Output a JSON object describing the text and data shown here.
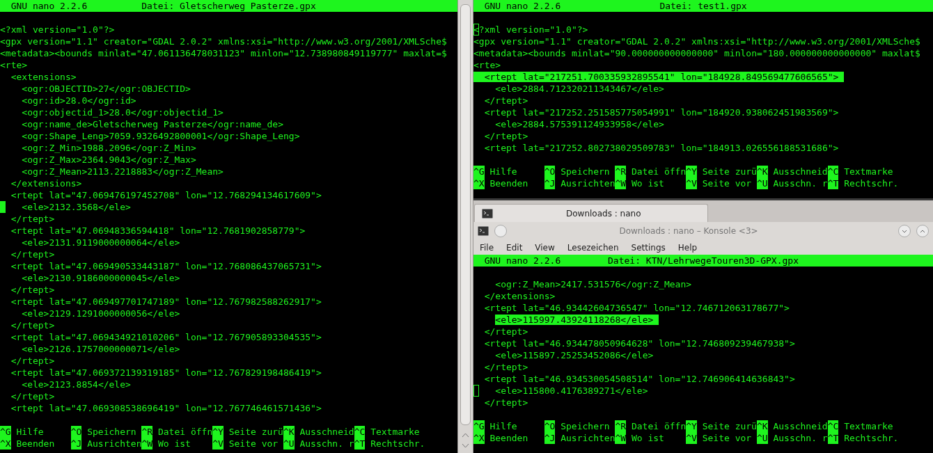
{
  "panes": [
    {
      "title": {
        "program": "GNU nano 2.2.6",
        "file": "Datei: Gletscherweg Pasterze.gpx"
      },
      "lines": [
        {
          "text": "<?xml version=\"1.0\"?>"
        },
        {
          "text": "<gpx version=\"1.1\" creator=\"GDAL 2.0.2\" xmlns:xsi=\"http://www.w3.org/2001/XMLSche$"
        },
        {
          "text": "<metadata><bounds minlat=\"47.061136478031123\" minlon=\"12.738980849119777\" maxlat=$"
        },
        {
          "text": "<rte>"
        },
        {
          "text": "  <extensions>"
        },
        {
          "text": "    <ogr:OBJECTID>27</ogr:OBJECTID>"
        },
        {
          "text": "    <ogr:id>28.0</ogr:id>"
        },
        {
          "text": "    <ogr:objectid_1>28.0</ogr:objectid_1>"
        },
        {
          "text": "    <ogr:name_de>Gletscherweg Pasterze</ogr:name_de>"
        },
        {
          "text": "    <ogr:Shape_Leng>7059.9326492800001</ogr:Shape_Leng>"
        },
        {
          "text": "    <ogr:Z_Min>1988.2096</ogr:Z_Min>"
        },
        {
          "text": "    <ogr:Z_Max>2364.9043</ogr:Z_Max>"
        },
        {
          "text": "    <ogr:Z_Mean>2113.2218883</ogr:Z_Mean>"
        },
        {
          "text": "  </extensions>"
        },
        {
          "text": "  <rtept lat=\"47.069476197452708\" lon=\"12.768294134617609\">"
        },
        {
          "text": "    <ele>2132.3568</ele>",
          "cursor": true,
          "cursor_active": true
        },
        {
          "text": "  </rtept>"
        },
        {
          "text": "  <rtept lat=\"47.06948336594418\" lon=\"12.7681902858779\">"
        },
        {
          "text": "    <ele>2131.9119000000064</ele>"
        },
        {
          "text": "  </rtept>"
        },
        {
          "text": "  <rtept lat=\"47.069490533443187\" lon=\"12.768086437065731\">"
        },
        {
          "text": "    <ele>2130.9186000000045</ele>"
        },
        {
          "text": "  </rtept>"
        },
        {
          "text": "  <rtept lat=\"47.069497701747189\" lon=\"12.767982588262917\">"
        },
        {
          "text": "    <ele>2129.1291000000056</ele>"
        },
        {
          "text": "  </rtept>"
        },
        {
          "text": "  <rtept lat=\"47.069434921010206\" lon=\"12.767905893304535\">"
        },
        {
          "text": "    <ele>2126.1757000000071</ele>"
        },
        {
          "text": "  </rtept>"
        },
        {
          "text": "  <rtept lat=\"47.069372139319185\" lon=\"12.767829198486419\">"
        },
        {
          "text": "    <ele>2123.8854</ele>"
        },
        {
          "text": "  </rtept>"
        },
        {
          "text": "  <rtept lat=\"47.069308538696419\" lon=\"12.767746461571436\">"
        }
      ],
      "shortcuts": [
        [
          {
            "key": "^G",
            "label": "Hilfe"
          },
          {
            "key": "^O",
            "label": "Speichern"
          },
          {
            "key": "^R",
            "label": "Datei öffn"
          },
          {
            "key": "^Y",
            "label": "Seite zurü"
          },
          {
            "key": "^K",
            "label": "Ausschneid"
          },
          {
            "key": "^C",
            "label": "Textmarke"
          }
        ],
        [
          {
            "key": "^X",
            "label": "Beenden"
          },
          {
            "key": "^J",
            "label": "Ausrichten"
          },
          {
            "key": "^W",
            "label": "Wo ist"
          },
          {
            "key": "^V",
            "label": "Seite vor"
          },
          {
            "key": "^U",
            "label": "Ausschn. r"
          },
          {
            "key": "^T",
            "label": "Rechtschr."
          }
        ]
      ]
    },
    {
      "title": {
        "program": "GNU nano 2.2.6",
        "file": "Datei: test1.gpx"
      },
      "lines": [
        {
          "text": "<?xml version=\"1.0\"?>",
          "cursor": true,
          "cursor_active": false
        },
        {
          "text": "<gpx version=\"1.1\" creator=\"GDAL 2.0.2\" xmlns:xsi=\"http://www.w3.org/2001/XMLSche$"
        },
        {
          "text": "<metadata><bounds minlat=\"90.000000000000000\" minlon=\"180.000000000000000\" maxlat$"
        },
        {
          "text": "<rte>"
        },
        {
          "text": "  <rtept lat=\"217251.700335932895541\" lon=\"184928.849569477606565\">",
          "selected": true,
          "selected_from_line_start": true
        },
        {
          "text": "    <ele>2884.712320211343467</ele>"
        },
        {
          "text": "  </rtept>"
        },
        {
          "text": "  <rtept lat=\"217252.251585775054991\" lon=\"184920.938062451983569\">"
        },
        {
          "text": "    <ele>2884.575391124933958</ele>"
        },
        {
          "text": "  </rtept>"
        },
        {
          "text": "  <rtept lat=\"217252.802738029509783\" lon=\"184913.026556188531686\">"
        }
      ],
      "shortcuts": [
        [
          {
            "key": "^G",
            "label": "Hilfe"
          },
          {
            "key": "^O",
            "label": "Speichern"
          },
          {
            "key": "^R",
            "label": "Datei öffn"
          },
          {
            "key": "^Y",
            "label": "Seite zurü"
          },
          {
            "key": "^K",
            "label": "Ausschneid"
          },
          {
            "key": "^C",
            "label": "Textmarke"
          }
        ],
        [
          {
            "key": "^X",
            "label": "Beenden"
          },
          {
            "key": "^J",
            "label": "Ausrichten"
          },
          {
            "key": "^W",
            "label": "Wo ist"
          },
          {
            "key": "^V",
            "label": "Seite vor"
          },
          {
            "key": "^U",
            "label": "Ausschn. r"
          },
          {
            "key": "^T",
            "label": "Rechtschr."
          }
        ]
      ]
    },
    {
      "title": {
        "program": "GNU nano 2.2.6",
        "file": "Datei: KTN/LehrwegeTouren3D-GPX.gpx"
      },
      "lines": [
        {
          "text": "    <ogr:Z_Mean>2417.531576</ogr:Z_Mean>"
        },
        {
          "text": "  </extensions>"
        },
        {
          "text": "  <rtept lat=\"46.93442604736547\" lon=\"12.746712063178677\">"
        },
        {
          "text": "    <ele>115997.43924118268</ele>",
          "selected": true,
          "selected_from_line_start": false
        },
        {
          "text": "  </rtept>"
        },
        {
          "text": "  <rtept lat=\"46.934478050964628\" lon=\"12.746809239467938\">"
        },
        {
          "text": "    <ele>115897.25253452086</ele>"
        },
        {
          "text": "  </rtept>"
        },
        {
          "text": "  <rtept lat=\"46.934530054508514\" lon=\"12.746906414636843\">"
        },
        {
          "text": "    <ele>115800.4176389271</ele>",
          "cursor": true,
          "cursor_active": false
        },
        {
          "text": "  </rtept>"
        }
      ],
      "shortcuts": [
        [
          {
            "key": "^G",
            "label": "Hilfe"
          },
          {
            "key": "^O",
            "label": "Speichern"
          },
          {
            "key": "^R",
            "label": "Datei öffn"
          },
          {
            "key": "^Y",
            "label": "Seite zurü"
          },
          {
            "key": "^K",
            "label": "Ausschneid"
          },
          {
            "key": "^C",
            "label": "Textmarke"
          }
        ],
        [
          {
            "key": "^X",
            "label": "Beenden"
          },
          {
            "key": "^J",
            "label": "Ausrichten"
          },
          {
            "key": "^W",
            "label": "Wo ist"
          },
          {
            "key": "^V",
            "label": "Seite vor"
          },
          {
            "key": "^U",
            "label": "Ausschn. r"
          },
          {
            "key": "^T",
            "label": "Rechtschr."
          }
        ]
      ]
    }
  ],
  "konsole": {
    "tabs": [
      {
        "label": "Downloads : nano",
        "selected": true
      }
    ],
    "title": "Downloads : nano – Konsole <3>",
    "menu": [
      "File",
      "Edit",
      "View",
      "Lesezeichen",
      "Settings",
      "Help"
    ]
  }
}
